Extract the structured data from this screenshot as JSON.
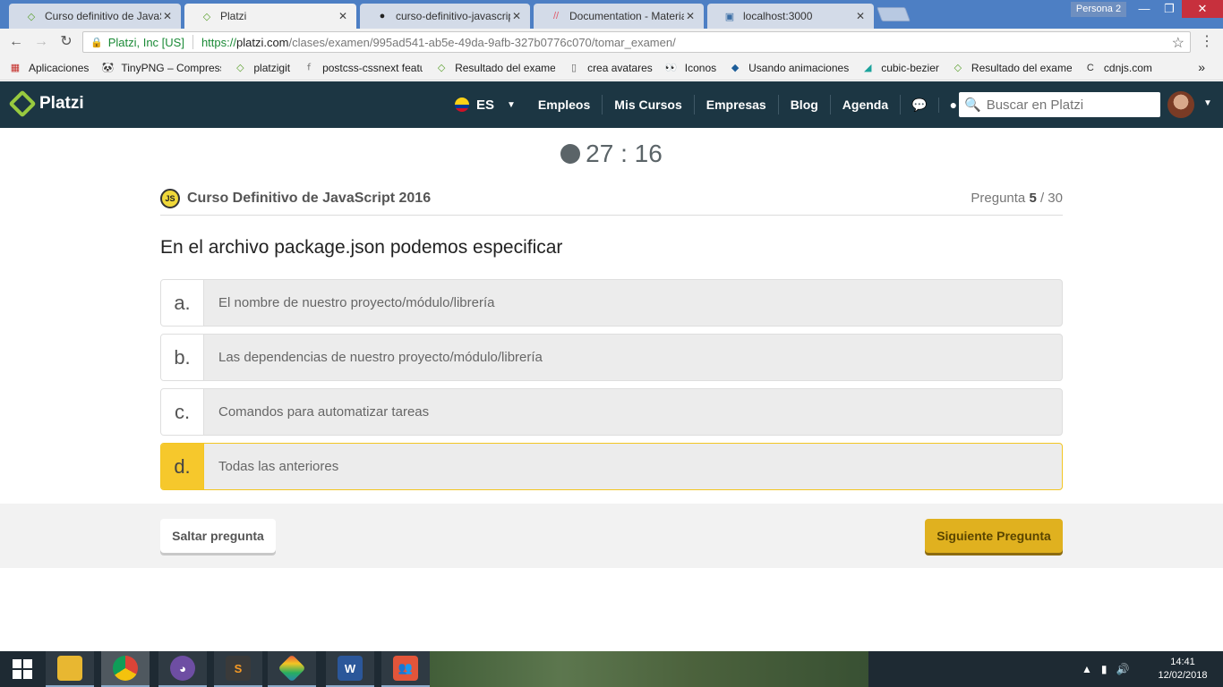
{
  "browser": {
    "tabs": [
      {
        "label": "Curso definitivo de JavaS",
        "icon": "platzi-icon",
        "active": false
      },
      {
        "label": "Platzi",
        "icon": "platzi-icon",
        "active": true
      },
      {
        "label": "curso-definitivo-javascrip",
        "icon": "github-icon",
        "active": false
      },
      {
        "label": "Documentation - Materia",
        "icon": "materialize-icon",
        "active": false
      },
      {
        "label": "localhost:3000",
        "icon": "page-icon",
        "active": false
      }
    ],
    "profile": "Persona 2",
    "address": {
      "secure_label": "Platzi, Inc [US]",
      "scheme": "https://",
      "host": "platzi.com",
      "path": "/clases/examen/995ad541-ab5e-49da-9afb-327b0776c070/tomar_examen/"
    },
    "bookmarks": [
      {
        "label": "Aplicaciones",
        "icon": "apps-grid-icon"
      },
      {
        "label": "TinyPNG – Compress",
        "icon": "panda-icon"
      },
      {
        "label": "platzigit",
        "icon": "platzi-icon"
      },
      {
        "label": "postcss-cssnext featu",
        "icon": "postcss-icon"
      },
      {
        "label": "Resultado del exame",
        "icon": "platzi-icon"
      },
      {
        "label": "crea avatares",
        "icon": "page-icon"
      },
      {
        "label": "Iconos",
        "icon": "eyes-icon"
      },
      {
        "label": "Usando animaciones",
        "icon": "bird-icon"
      },
      {
        "label": "cubic-bezier",
        "icon": "curve-icon"
      },
      {
        "label": "Resultado del exame",
        "icon": "platzi-icon"
      },
      {
        "label": "cdnjs.com",
        "icon": "cdnjs-icon"
      }
    ]
  },
  "platzi": {
    "logo": "Platzi",
    "lang": "ES",
    "nav": [
      "Empleos",
      "Mis Cursos",
      "Empresas",
      "Blog",
      "Agenda"
    ],
    "search_placeholder": "Buscar en Platzi"
  },
  "exam": {
    "timer": "27 : 16",
    "course_badge": "JS",
    "course_name": "Curso Definitivo de JavaScript 2016",
    "question_prefix": "Pregunta",
    "question_number": "5",
    "question_total": "/ 30",
    "question_text": "En el archivo package.json podemos especificar",
    "options": [
      {
        "letter": "a.",
        "text": "El nombre de nuestro proyecto/módulo/librería",
        "selected": false
      },
      {
        "letter": "b.",
        "text": "Las dependencias de nuestro proyecto/módulo/librería",
        "selected": false
      },
      {
        "letter": "c.",
        "text": "Comandos para automatizar tareas",
        "selected": false
      },
      {
        "letter": "d.",
        "text": "Todas las anteriores",
        "selected": true
      }
    ],
    "skip_label": "Saltar pregunta",
    "next_label": "Siguiente Pregunta"
  },
  "taskbar": {
    "apps": [
      "file-explorer-icon",
      "chrome-icon",
      "github-desktop-icon",
      "sublime-icon",
      "gitkraken-icon",
      "word-icon",
      "people-icon"
    ],
    "time": "14:41",
    "date": "12/02/2018"
  },
  "colors": {
    "header_bg": "#1c3643",
    "accent_green": "#98ca3f",
    "selected_yellow": "#f6c82c",
    "next_button": "#e0b11f"
  }
}
